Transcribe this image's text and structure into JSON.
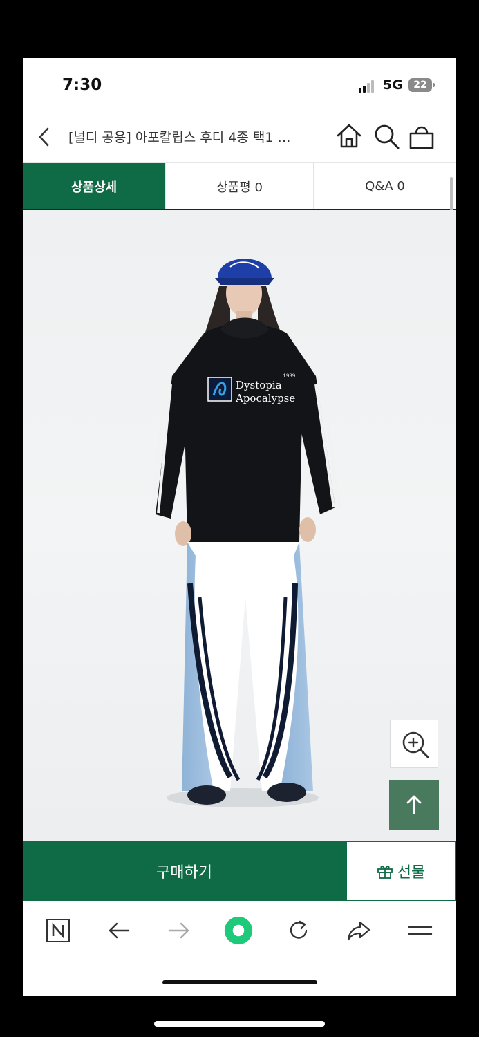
{
  "status_bar": {
    "time": "7:30",
    "network": "5G",
    "battery": "22"
  },
  "header": {
    "title": "[널디 공용] 아포칼립스 후디 4종 택1 …"
  },
  "tabs": [
    {
      "label": "상품상세",
      "active": true
    },
    {
      "label": "상품평 0",
      "active": false
    },
    {
      "label": "Q&A 0",
      "active": false
    }
  ],
  "product_print": {
    "line1": "Dystopia",
    "line2": "Apocalypse",
    "year": "1999"
  },
  "actions": {
    "buy_label": "구매하기",
    "gift_label": "선물"
  },
  "icons": {
    "back": "chevron-left-icon",
    "home": "home-icon",
    "search": "search-icon",
    "bag": "shopping-bag-icon",
    "zoom": "zoom-in-icon",
    "top": "arrow-up-icon",
    "gift": "gift-icon"
  },
  "colors": {
    "brand": "#0f6b45",
    "top_button": "#4a7a5e",
    "browser_accent": "#1ec97a"
  }
}
